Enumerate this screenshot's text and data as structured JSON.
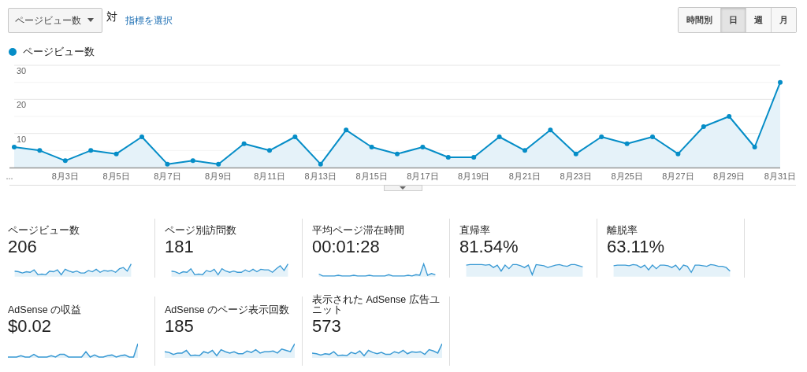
{
  "metric_picker": {
    "value": "ページビュー数"
  },
  "versus": "対",
  "select_metric_link": "指標を選択",
  "granularity": [
    {
      "label": "時間別",
      "selected": false
    },
    {
      "label": "日",
      "selected": true
    },
    {
      "label": "週",
      "selected": false
    },
    {
      "label": "月",
      "selected": false
    }
  ],
  "chart": {
    "chart_data": {
      "type": "area",
      "categories": [
        "...",
        null,
        "8月3日",
        null,
        "8月5日",
        null,
        "8月7日",
        null,
        "8月9日",
        null,
        "8月11日",
        null,
        "8月13日",
        null,
        "8月15日",
        null,
        "8月17日",
        null,
        "8月19日",
        null,
        "8月21日",
        null,
        "8月23日",
        null,
        "8月25日",
        null,
        "8月27日",
        null,
        "8月29日",
        null,
        "8月31日"
      ],
      "series": [
        {
          "name": "ページビュー数",
          "color": "#058dc7",
          "values": [
            6,
            5,
            2,
            5,
            4,
            9,
            1,
            2,
            1,
            7,
            5,
            9,
            1,
            11,
            6,
            4,
            6,
            3,
            3,
            9,
            5,
            11,
            4,
            9,
            7,
            9,
            4,
            12,
            15,
            6,
            25
          ]
        }
      ],
      "yticks": [
        10,
        20,
        30
      ],
      "ylim": [
        0,
        30
      ]
    }
  },
  "metrics": [
    {
      "label": "ページビュー数",
      "value": "206"
    },
    {
      "label": "ページ別訪問数",
      "value": "181"
    },
    {
      "label": "平均ページ滞在時間",
      "value": "00:01:28"
    },
    {
      "label": "直帰率",
      "value": "81.54%"
    },
    {
      "label": "離脱率",
      "value": "63.11%"
    },
    {
      "label": "AdSense の収益",
      "value": "$0.02"
    },
    {
      "label": "AdSense のページ表示回数",
      "value": "185"
    },
    {
      "label": "表示された AdSense 広告ユニット",
      "value": "573"
    }
  ]
}
